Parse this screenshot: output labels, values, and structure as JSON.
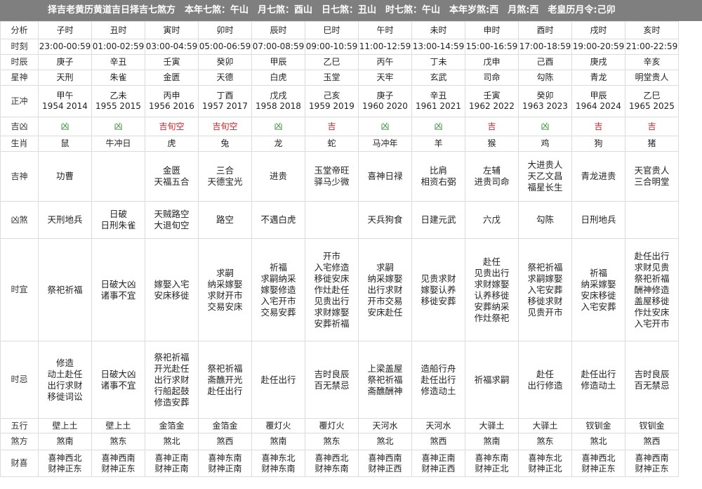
{
  "header": "择吉老黄历黄道吉日择吉七煞方　本年七煞：午山　月七煞：酉山　日七煞：丑山　时七煞：午山　本年岁煞:西　月煞:西　老皇历月令:己卯",
  "colors": {
    "lucky": "#d0262b",
    "bad": "#2e8b2e",
    "header_bg": "#7f7f7f"
  },
  "rows": [
    {
      "key": "fenxi",
      "label": "分析",
      "h": 25,
      "values": [
        "子时",
        "丑时",
        "寅时",
        "卯时",
        "辰时",
        "巳时",
        "午时",
        "未时",
        "申时",
        "酉时",
        "戌时",
        "亥时"
      ]
    },
    {
      "key": "shike",
      "label": "时刻",
      "h": 22,
      "values": [
        "23:00-00:59",
        "01:00-02:59",
        "03:00-04:59",
        "05:00-06:59",
        "07:00-08:59",
        "09:00-10:59",
        "11:00-12:59",
        "13:00-14:59",
        "15:00-16:59",
        "17:00-18:59",
        "19:00-20:59",
        "21:00-22:59"
      ]
    },
    {
      "key": "shichen",
      "label": "时辰",
      "h": 22,
      "values": [
        "庚子",
        "辛丑",
        "壬寅",
        "癸卯",
        "甲辰",
        "乙巳",
        "丙午",
        "丁未",
        "戊申",
        "己酉",
        "庚戌",
        "辛亥"
      ]
    },
    {
      "key": "xingshen",
      "label": "星神",
      "h": 22,
      "values": [
        "天刑",
        "朱雀",
        "金匮",
        "天德",
        "白虎",
        "玉堂",
        "天牢",
        "玄武",
        "司命",
        "勾陈",
        "青龙",
        "明堂贵人"
      ]
    },
    {
      "key": "zhengchong",
      "label": "正冲",
      "h": 45,
      "values": [
        "甲午\n1954 2014",
        "乙未\n1955 2015",
        "丙申\n1956 2016",
        "丁酉\n1957 2017",
        "戊戌\n1958 2018",
        "己亥\n1959 2019",
        "庚子\n1960 2020",
        "辛丑\n1961 2021",
        "壬寅\n1962 2022",
        "癸卯\n1963 2023",
        "甲辰\n1964 2024",
        "乙巳\n1965 2025"
      ]
    },
    {
      "key": "jixiong",
      "label": "吉凶",
      "h": 27,
      "values": [
        "凶",
        "凶",
        "吉旬空",
        "吉旬空",
        "凶",
        "吉",
        "凶",
        "凶",
        "吉",
        "凶",
        "吉",
        "吉"
      ],
      "status": [
        "bad",
        "bad",
        "lucky",
        "lucky",
        "bad",
        "lucky",
        "bad",
        "bad",
        "lucky",
        "bad",
        "lucky",
        "lucky"
      ]
    },
    {
      "key": "shengxiao",
      "label": "生肖",
      "h": 22,
      "values": [
        "鼠",
        "牛冲日",
        "虎",
        "兔",
        "龙",
        "蛇",
        "马冲年",
        "羊",
        "猴",
        "鸡",
        "狗",
        "猪"
      ]
    },
    {
      "key": "jishen",
      "label": "吉神",
      "h": 71,
      "big": true,
      "values": [
        "功曹",
        "",
        "金匮\n天福五合",
        "三合\n天德宝光",
        "进贵",
        "玉堂帝旺\n驿马少微",
        "喜神日禄",
        "比肩\n相资右弼",
        "左辅\n进贵司命",
        "大进贵人\n天乙文昌\n福星长生",
        "青龙进贵",
        "天官贵人\n三合明堂"
      ]
    },
    {
      "key": "xiongsha",
      "label": "凶煞",
      "h": 53,
      "big": true,
      "values": [
        "天刑地兵",
        "日破\n日刑朱雀",
        "天贼路空\n大退旬空",
        "路空",
        "不遇白虎",
        "",
        "天兵狗食",
        "日建元武",
        "六戊",
        "勾陈",
        "日刑地兵",
        ""
      ]
    },
    {
      "key": "shiyi",
      "label": "时宜",
      "h": 146,
      "big": true,
      "values": [
        "祭祀祈福",
        "日破大凶\n诸事不宜",
        "嫁娶入宅\n安床移徙",
        "求嗣\n纳采嫁娶\n求财开市\n交易安床",
        "祈福\n求嗣纳采\n嫁娶修造\n入宅开市\n交易安葬",
        "开市\n入宅修造\n移徙安床\n作灶赴任\n见贵出行\n求财嫁娶\n安葬祈福",
        "求嗣\n纳采嫁娶\n出行求财\n开市交易\n安床赴任",
        "见贵求财\n嫁娶认养\n移徙安葬",
        "赴任\n见贵出行\n求财嫁娶\n认养移徙\n安葬纳采\n作灶祭祀",
        "祭祀祈福\n求嗣嫁娶\n入宅安葬\n移徙求财\n见贵开市",
        "祈福\n纳采嫁娶\n安床移徙\n入宅安葬",
        "赴任出行\n求财见贵\n祭祀祈福\n酬神修造\n盖屋移徙\n作灶安床\n入宅开市"
      ]
    },
    {
      "key": "shiji",
      "label": "时忌",
      "h": 110,
      "big": true,
      "values": [
        "修造\n动土赴任\n出行求财\n移徙词讼",
        "日破大凶\n诸事不宜",
        "祭祀祈福\n开光赴任\n出行求财\n行船起鼓\n修造安葬",
        "祭祀祈福\n斋醮开光\n赴任出行",
        "赴任出行",
        "吉时良辰\n百无禁忌",
        "上梁盖屋\n祭祀祈福\n斋醮酬神",
        "造船行舟\n赴任出行\n修造动土",
        "祈福求嗣",
        "赴任\n出行修造",
        "赴任出行\n修造动土",
        "吉时良辰\n百无禁忌"
      ]
    },
    {
      "key": "wuxing",
      "label": "五行",
      "h": 21,
      "values": [
        "壁上土",
        "壁上土",
        "金箔金",
        "金箔金",
        "覆灯火",
        "覆灯火",
        "天河水",
        "天河水",
        "大驿土",
        "大驿土",
        "钗钏金",
        "钗钏金"
      ]
    },
    {
      "key": "shafang",
      "label": "煞方",
      "h": 24,
      "values": [
        "煞南",
        "煞东",
        "煞北",
        "煞西",
        "煞南",
        "煞东",
        "煞北",
        "煞西",
        "煞南",
        "煞东",
        "煞北",
        "煞西"
      ]
    },
    {
      "key": "caixi",
      "label": "财喜",
      "h": 38,
      "values": [
        "喜神西北\n财神正东",
        "喜神西南\n财神正东",
        "喜神正南\n财神正南",
        "喜神东南\n财神正南",
        "喜神东北\n财神东南",
        "喜神西北\n财神东南",
        "喜神西南\n财神正西",
        "喜神正南\n财神正西",
        "喜神东南\n财神正北",
        "喜神东北\n财神正北",
        "喜神西北\n财神正东",
        "喜神西南\n财神正东"
      ]
    }
  ]
}
